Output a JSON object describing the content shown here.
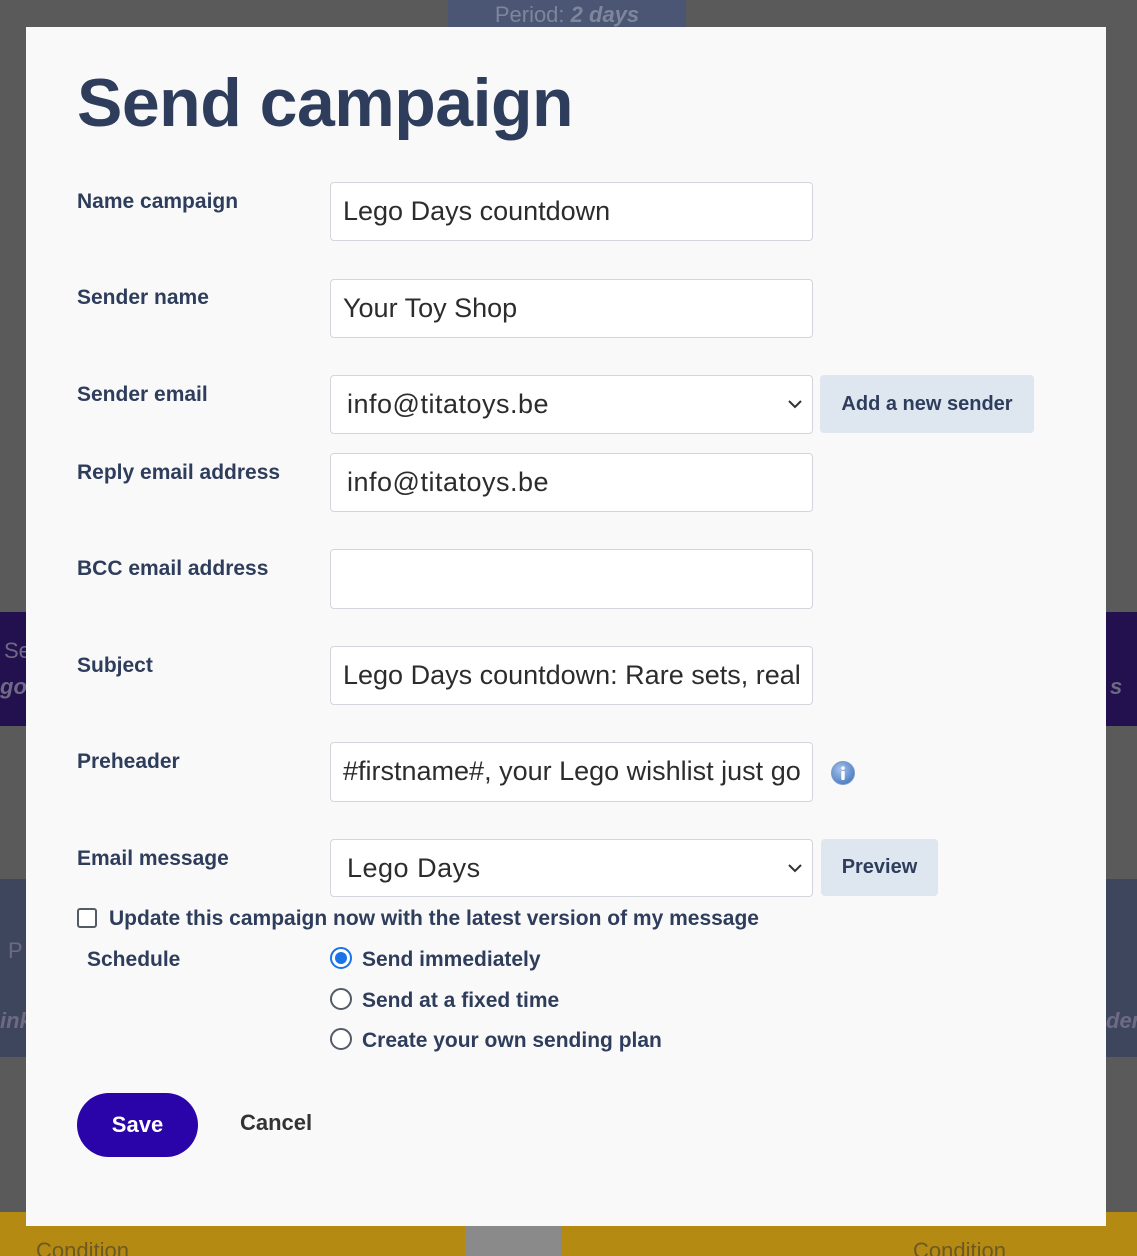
{
  "background": {
    "period_label": "Period:",
    "period_value": "2 days",
    "fragment_se": "Se",
    "fragment_go": "go",
    "fragment_s": "s",
    "fragment_p": "P",
    "fragment_ink": "ink",
    "fragment_der": "der",
    "condition_left": "Condition",
    "condition_right": "Condition"
  },
  "modal": {
    "title": "Send campaign",
    "fields": {
      "name_campaign": {
        "label": "Name campaign",
        "value": "Lego Days countdown"
      },
      "sender_name": {
        "label": "Sender name",
        "value": "Your Toy Shop"
      },
      "sender_email": {
        "label": "Sender email",
        "value": "info@titatoys.be",
        "add_button": "Add a new sender"
      },
      "reply_email": {
        "label": "Reply email address",
        "value": "info@titatoys.be"
      },
      "bcc_email": {
        "label": "BCC email address",
        "value": ""
      },
      "subject": {
        "label": "Subject",
        "value": "Lego Days countdown: Rare sets, real"
      },
      "preheader": {
        "label": "Preheader",
        "value": "#firstname#, your Lego wishlist just go"
      },
      "email_message": {
        "label": "Email message",
        "value": "Lego Days",
        "preview_button": "Preview"
      }
    },
    "update_checkbox": {
      "label": "Update this campaign now with the latest version of my message",
      "checked": false
    },
    "schedule": {
      "label": "Schedule",
      "options": [
        {
          "label": "Send immediately",
          "selected": true
        },
        {
          "label": "Send at a fixed time",
          "selected": false
        },
        {
          "label": "Create your own sending plan",
          "selected": false
        }
      ]
    },
    "actions": {
      "save": "Save",
      "cancel": "Cancel"
    }
  },
  "colors": {
    "title": "#2f3d5c",
    "primary_button": "#2a04a8",
    "secondary_button": "#dee7ef",
    "radio_selected": "#1a73e8"
  }
}
